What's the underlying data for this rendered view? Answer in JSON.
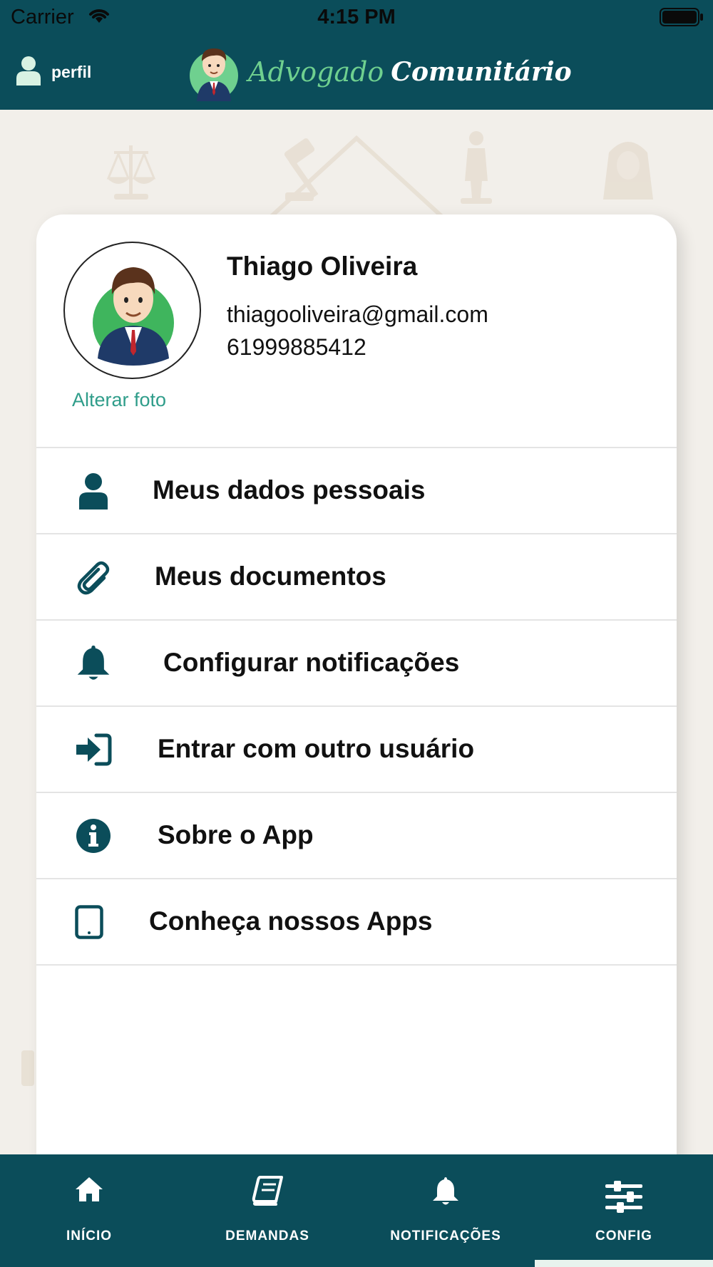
{
  "status_bar": {
    "carrier": "Carrier",
    "time": "4:15 PM"
  },
  "header": {
    "profile_label": "perfil",
    "logo_word1": "Advogado",
    "logo_word2": "Comunitário"
  },
  "profile": {
    "name": "Thiago Oliveira",
    "email": "thiagooliveira@gmail.com",
    "phone": "61999885412",
    "change_photo": "Alterar foto"
  },
  "menu": {
    "items": [
      {
        "label": "Meus dados pessoais",
        "icon": "user-icon"
      },
      {
        "label": "Meus documentos",
        "icon": "paperclip-icon"
      },
      {
        "label": "Configurar notificações",
        "icon": "bell-icon"
      },
      {
        "label": "Entrar com outro usuário",
        "icon": "sign-in-icon"
      },
      {
        "label": "Sobre o App",
        "icon": "info-icon"
      },
      {
        "label": "Conheça nossos Apps",
        "icon": "tablet-icon"
      }
    ]
  },
  "tabs": [
    {
      "label": "INÍCIO",
      "icon": "home-icon"
    },
    {
      "label": "DEMANDAS",
      "icon": "book-icon"
    },
    {
      "label": "NOTIFICAÇÕES",
      "icon": "bell-icon"
    },
    {
      "label": "CONFIG",
      "icon": "sliders-icon",
      "active": true
    }
  ],
  "colors": {
    "primary": "#0b4d5a",
    "accent_green": "#6fd08f",
    "link_teal": "#2f9d8a",
    "background": "#f2efea"
  }
}
